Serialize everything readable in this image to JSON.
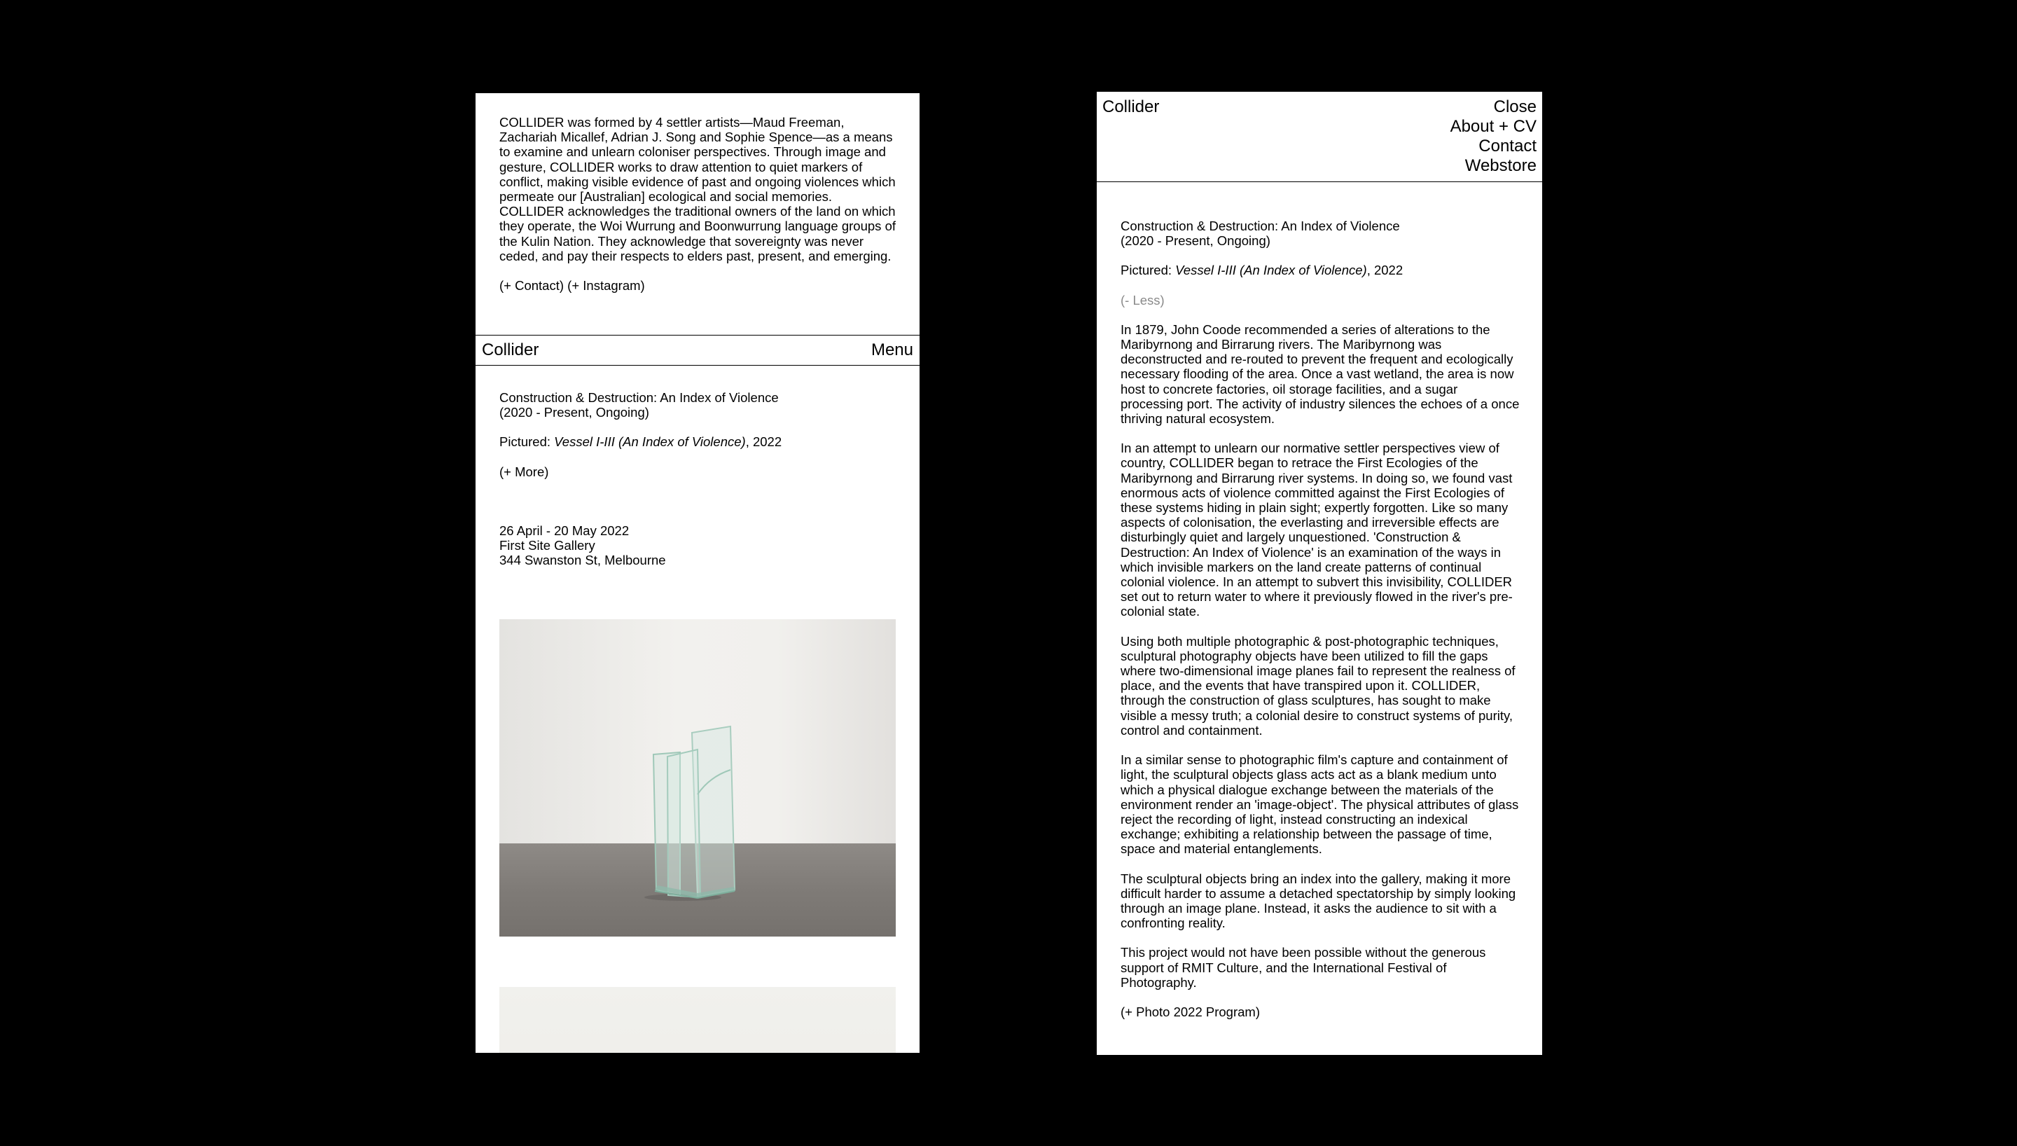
{
  "left": {
    "intro": "COLLIDER was formed by 4 settler artists—Maud Freeman, Zachariah Micallef, Adrian J. Song and Sophie Spence—as a means to examine and unlearn coloniser perspectives. Through image and gesture, COLLIDER works to draw attention to quiet markers of conflict, making visible evidence of past and ongoing violences which permeate our [Australian] ecological and social memories. COLLIDER acknowledges the traditional owners of the land on which they operate, the Woi Wurrung and Boonwurrung language groups of the Kulin Nation. They acknowledge that sovereignty was never ceded, and pay their respects to elders past, present, and emerging.",
    "contact_link": "(+ Contact)",
    "instagram_link": "(+ Instagram)",
    "nav": {
      "logo": "Collider",
      "menu": "Menu"
    },
    "project": {
      "title_line1": "Construction & Destruction: An Index of Violence",
      "title_line2": "(2020 - Present, Ongoing)",
      "pictured_label": "Pictured:",
      "pictured_title": "Vessel I-III (An Index of Violence)",
      "pictured_year": ", 2022",
      "more_link": "(+ More)",
      "dates": "26 April - 20 May 2022",
      "venue": "First Site Gallery",
      "address": "344 Swanston St, Melbourne"
    }
  },
  "right": {
    "header": {
      "logo": "Collider",
      "menu": [
        "Close",
        "About + CV",
        "Contact",
        "Webstore"
      ]
    },
    "project": {
      "title_line1": "Construction & Destruction: An Index of Violence",
      "title_line2": "(2020 - Present, Ongoing)",
      "pictured_label": "Pictured:",
      "pictured_title": "Vessel I-III (An Index of Violence)",
      "pictured_year": ", 2022",
      "less_link": "(- Less)",
      "paragraphs": [
        "In 1879, John Coode recommended a series of alterations to the Maribyrnong and Birrarung rivers. The Maribyrnong was deconstructed and re-routed to prevent the frequent and ecologically necessary flooding of the area. Once a vast wetland, the area is now host to concrete factories, oil storage facilities, and a sugar processing port. The activity of industry silences the echoes of a once thriving natural ecosystem.",
        "In an attempt to unlearn our normative settler perspectives view of country, COLLIDER began to retrace the First Ecologies of the Maribyrnong and Birrarung river systems. In doing so, we found vast enormous acts of violence committed against the First Ecologies of these systems hiding in plain sight; expertly forgotten. Like so many aspects of colonisation, the everlasting and irreversible effects are disturbingly quiet and largely unquestioned. 'Construction & Destruction: An Index of Violence' is an examination of the ways in which invisible markers on the land create patterns of continual colonial violence. In an attempt to subvert this invisibility, COLLIDER set out to return water to where it previously flowed in the river's pre-colonial state.",
        "Using both multiple photographic & post-photographic techniques, sculptural photography objects have been utilized to fill the gaps where two-dimensional image planes fail to represent the realness of place, and the events that have transpired upon it. COLLIDER, through the construction of glass sculptures, has sought to make visible a messy truth; a colonial desire to construct systems of purity, control and containment.",
        "In a similar sense to photographic film's capture and containment of light, the sculptural objects glass acts act as a blank medium unto which a physical dialogue exchange between the materials of the environment render an 'image-object'. The physical attributes of glass reject the recording of light, instead constructing an indexical exchange; exhibiting a relationship between the passage of time, space and material entanglements.",
        "The sculptural objects bring an index into the gallery, making it more difficult harder to assume a detached spectatorship by simply looking through an image plane. Instead, it asks the audience to sit with a confronting reality.",
        "This project would not have been possible without the generous support of RMIT Culture, and the International Festival of Photography."
      ],
      "program_link": "(+ Photo 2022 Program)"
    }
  }
}
